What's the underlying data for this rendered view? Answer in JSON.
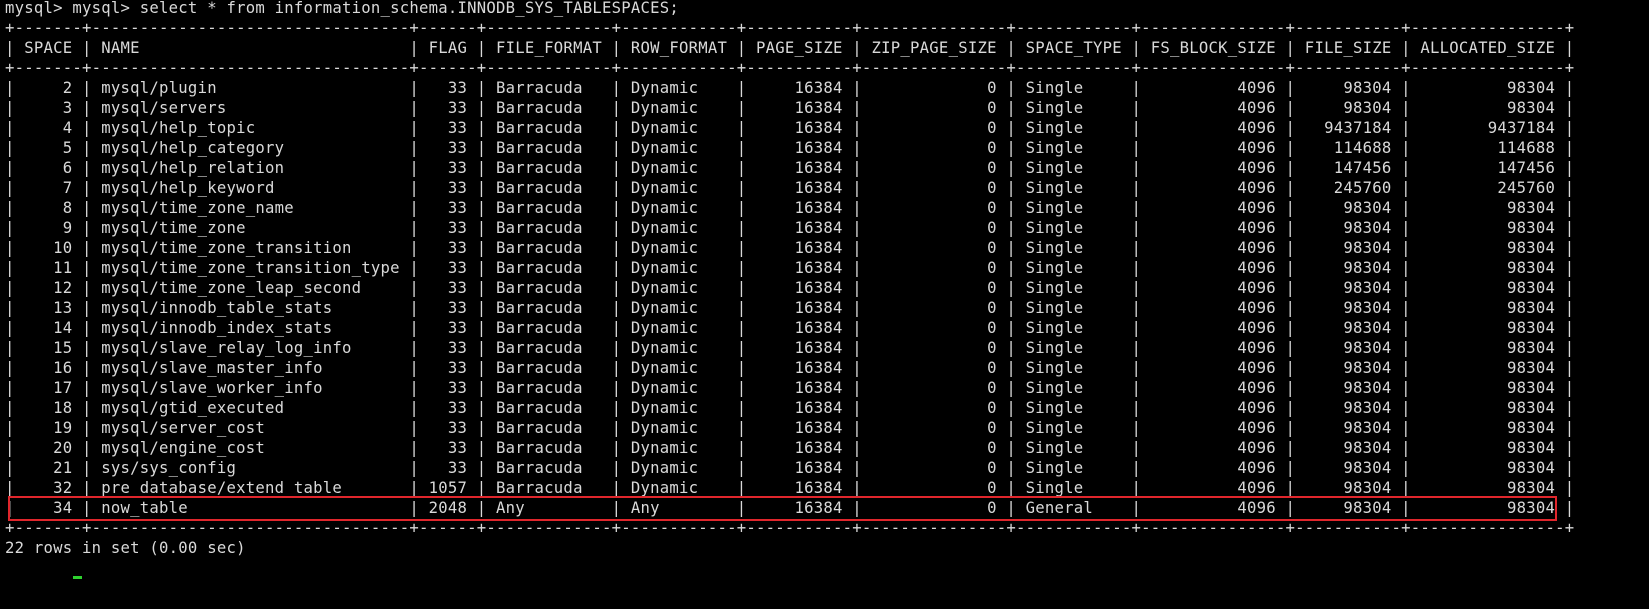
{
  "terminal": {
    "prompt_line": "mysql> mysql> select * from information_schema.INNODB_SYS_TABLESPACES;",
    "border_line": "+-------+---------------------------------+------+-------------+------------+-----------+---------------+------------+---------------+-----------+----------------+",
    "header_line": "| SPACE | NAME                            | FLAG | FILE_FORMAT | ROW_FORMAT | PAGE_SIZE | ZIP_PAGE_SIZE | SPACE_TYPE | FS_BLOCK_SIZE | FILE_SIZE | ALLOCATED_SIZE |",
    "rows": [
      "|     2 | mysql/plugin                    |   33 | Barracuda   | Dynamic    |     16384 |             0 | Single     |          4096 |     98304 |          98304 |",
      "|     3 | mysql/servers                   |   33 | Barracuda   | Dynamic    |     16384 |             0 | Single     |          4096 |     98304 |          98304 |",
      "|     4 | mysql/help_topic                |   33 | Barracuda   | Dynamic    |     16384 |             0 | Single     |          4096 |   9437184 |        9437184 |",
      "|     5 | mysql/help_category             |   33 | Barracuda   | Dynamic    |     16384 |             0 | Single     |          4096 |    114688 |         114688 |",
      "|     6 | mysql/help_relation             |   33 | Barracuda   | Dynamic    |     16384 |             0 | Single     |          4096 |    147456 |         147456 |",
      "|     7 | mysql/help_keyword              |   33 | Barracuda   | Dynamic    |     16384 |             0 | Single     |          4096 |    245760 |         245760 |",
      "|     8 | mysql/time_zone_name            |   33 | Barracuda   | Dynamic    |     16384 |             0 | Single     |          4096 |     98304 |          98304 |",
      "|     9 | mysql/time_zone                 |   33 | Barracuda   | Dynamic    |     16384 |             0 | Single     |          4096 |     98304 |          98304 |",
      "|    10 | mysql/time_zone_transition      |   33 | Barracuda   | Dynamic    |     16384 |             0 | Single     |          4096 |     98304 |          98304 |",
      "|    11 | mysql/time_zone_transition_type |   33 | Barracuda   | Dynamic    |     16384 |             0 | Single     |          4096 |     98304 |          98304 |",
      "|    12 | mysql/time_zone_leap_second     |   33 | Barracuda   | Dynamic    |     16384 |             0 | Single     |          4096 |     98304 |          98304 |",
      "|    13 | mysql/innodb_table_stats        |   33 | Barracuda   | Dynamic    |     16384 |             0 | Single     |          4096 |     98304 |          98304 |",
      "|    14 | mysql/innodb_index_stats        |   33 | Barracuda   | Dynamic    |     16384 |             0 | Single     |          4096 |     98304 |          98304 |",
      "|    15 | mysql/slave_relay_log_info      |   33 | Barracuda   | Dynamic    |     16384 |             0 | Single     |          4096 |     98304 |          98304 |",
      "|    16 | mysql/slave_master_info         |   33 | Barracuda   | Dynamic    |     16384 |             0 | Single     |          4096 |     98304 |          98304 |",
      "|    17 | mysql/slave_worker_info         |   33 | Barracuda   | Dynamic    |     16384 |             0 | Single     |          4096 |     98304 |          98304 |",
      "|    18 | mysql/gtid_executed             |   33 | Barracuda   | Dynamic    |     16384 |             0 | Single     |          4096 |     98304 |          98304 |",
      "|    19 | mysql/server_cost               |   33 | Barracuda   | Dynamic    |     16384 |             0 | Single     |          4096 |     98304 |          98304 |",
      "|    20 | mysql/engine_cost               |   33 | Barracuda   | Dynamic    |     16384 |             0 | Single     |          4096 |     98304 |          98304 |",
      "|    21 | sys/sys_config                  |   33 | Barracuda   | Dynamic    |     16384 |             0 | Single     |          4096 |     98304 |          98304 |",
      "|    32 | pre_database/extend_table       | 1057 | Barracuda   | Dynamic    |     16384 |             0 | Single     |          4096 |     98304 |          98304 |",
      "|    34 | now_table                       | 2048 | Any         | Any        |     16384 |             0 | General    |          4096 |     98304 |          98304 |"
    ],
    "result_line": "22 rows in set (0.00 sec)",
    "colors": {
      "background": "#000000",
      "text": "#d9d9d9",
      "highlight_border": "#e0262c",
      "cursor": "#2ed12e"
    }
  }
}
